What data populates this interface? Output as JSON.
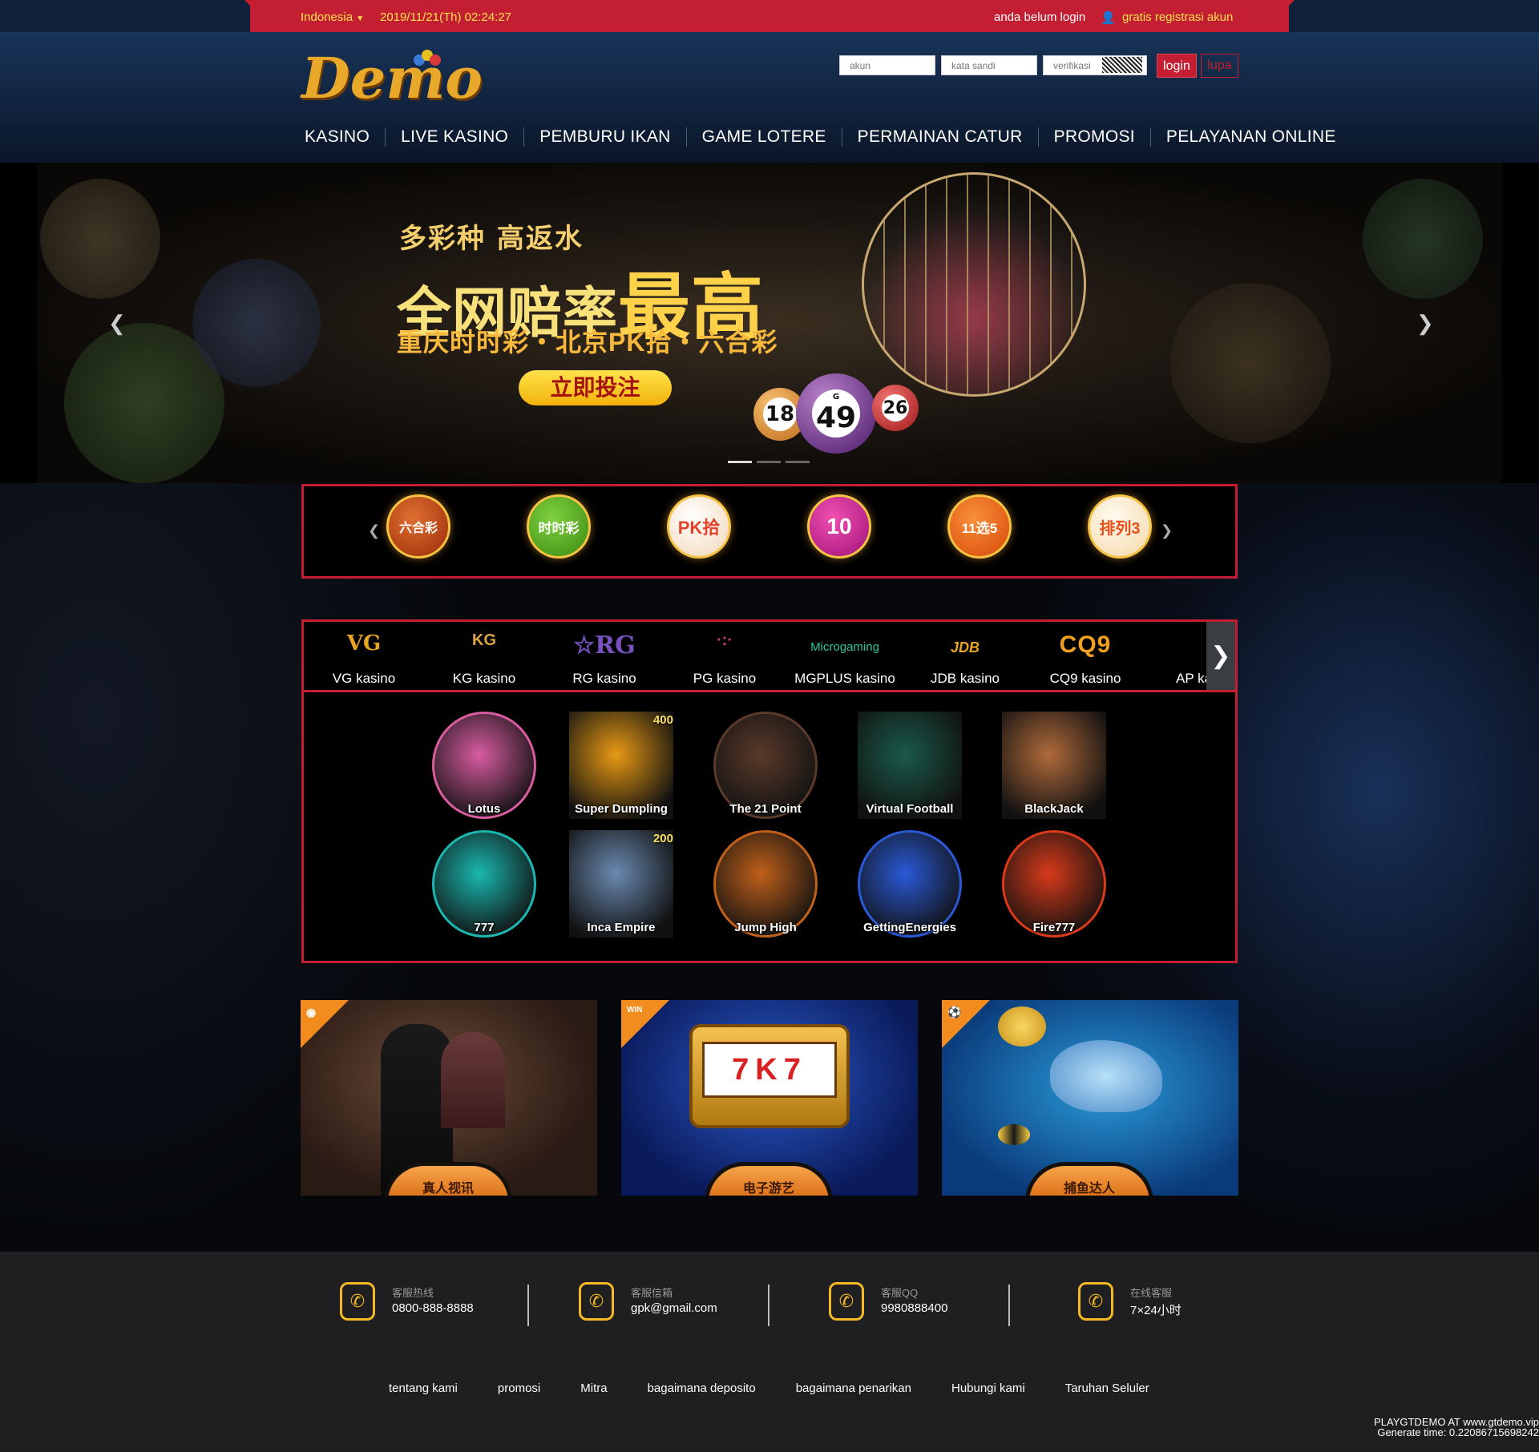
{
  "topbar": {
    "language": "Indonesia",
    "datetime": "2019/11/21(Th) 02:24:27",
    "login_status": "anda belum login",
    "register_link": "gratis registrasi akun"
  },
  "header": {
    "logo_text": "Demo",
    "account_placeholder": "akun",
    "password_placeholder": "kata sandi",
    "verify_placeholder": "verifikasi",
    "login_label": "login",
    "forgot_label": "lupa"
  },
  "nav": [
    "KASINO",
    "LIVE KASINO",
    "PEMBURU IKAN",
    "GAME LOTERE",
    "PERMAINAN CATUR",
    "PROMOSI",
    "PELAYANAN ONLINE"
  ],
  "banner": {
    "line1": "多彩种 高返水",
    "line2a": "全网赔率",
    "line2b": "最高",
    "line3": "重庆时时彩・北京PK拾・六合彩",
    "button": "立即投注",
    "balls": [
      "18",
      "49",
      "26"
    ],
    "ball_letter": "G",
    "slide_active": 1
  },
  "lotteries": [
    {
      "icon": "mark-six-lottery-icon",
      "text": "六合彩",
      "color": "#c1450f"
    },
    {
      "icon": "ssc-lottery-icon",
      "text": "时时彩",
      "color": "#58a61c"
    },
    {
      "icon": "pk10-lottery-icon",
      "text": "PK拾",
      "color": "#f5f0e8"
    },
    {
      "icon": "happy-ten-lottery-icon",
      "text": "10",
      "color": "#d02b92"
    },
    {
      "icon": "eleven-five-lottery-icon",
      "text": "11选5",
      "color": "#ef6b14"
    },
    {
      "icon": "pailie3-lottery-icon",
      "text": "排列3",
      "color": "#fff2d8"
    }
  ],
  "providers": [
    {
      "logo": "VG",
      "name": "VG kasino",
      "color": "#e8a620"
    },
    {
      "logo": "KG",
      "name": "KG kasino",
      "color": "#d9a446"
    },
    {
      "logo": "☆RG",
      "name": "RG kasino",
      "color": "#7a52c0"
    },
    {
      "logo": "·:·",
      "name": "PG kasino",
      "color": "#c04080"
    },
    {
      "logo": "Microgaming",
      "name": "MGPLUS kasino",
      "color": "#2ec4a0"
    },
    {
      "logo": "JDB",
      "name": "JDB kasino",
      "color": "#e8a620"
    },
    {
      "logo": "CQ9",
      "name": "CQ9 kasino",
      "color": "#f0a020"
    },
    {
      "logo": "",
      "name": "AP kasino",
      "color": "#fff"
    }
  ],
  "games": [
    {
      "name": "Lotus",
      "art": "#d85ca0",
      "round": true
    },
    {
      "name": "Super Dumpling",
      "art": "#e89a14",
      "round": false,
      "badge": "400"
    },
    {
      "name": "The 21 Point",
      "art": "#5a3a2a",
      "round": true
    },
    {
      "name": "Virtual Football",
      "art": "#1a5a4a",
      "round": false
    },
    {
      "name": "BlackJack",
      "art": "#b06a3a",
      "round": false
    },
    {
      "name": "777",
      "art": "#1ab8b0",
      "round": true
    },
    {
      "name": "Inca Empire",
      "art": "#6a8ab0",
      "round": false,
      "badge": "200"
    },
    {
      "name": "Jump High",
      "art": "#c0601a",
      "round": true
    },
    {
      "name": "GettingEnergies",
      "art": "#2a5ad8",
      "round": true
    },
    {
      "name": "Fire777",
      "art": "#d83a1a",
      "round": true
    }
  ],
  "promos": [
    {
      "label": "真人视讯",
      "corner": "chip-icon"
    },
    {
      "label": "电子游艺",
      "corner": "win-icon",
      "corner_text": "WIN"
    },
    {
      "label": "捕鱼达人",
      "corner": "ball-icon"
    }
  ],
  "contacts": [
    {
      "title": "客服热线",
      "value": "0800-888-8888"
    },
    {
      "title": "客服信箱",
      "value": "gpk@gmail.com"
    },
    {
      "title": "客服QQ",
      "value": "9980888400"
    },
    {
      "title": "在线客服",
      "value": "7×24小时"
    }
  ],
  "footer_links": [
    "tentang kami",
    "promosi",
    "Mitra",
    "bagaimana deposito",
    "bagaimana penarikan",
    "Hubungi kami",
    "Taruhan Seluler"
  ],
  "credit": {
    "line1": "PLAYGTDEMO AT www.gtdemo.vip",
    "line2": "Generate time: 0.22086715698242"
  },
  "colors": {
    "accent": "#c41e32",
    "gold": "#ffe14a",
    "orange": "#f28c1e"
  }
}
